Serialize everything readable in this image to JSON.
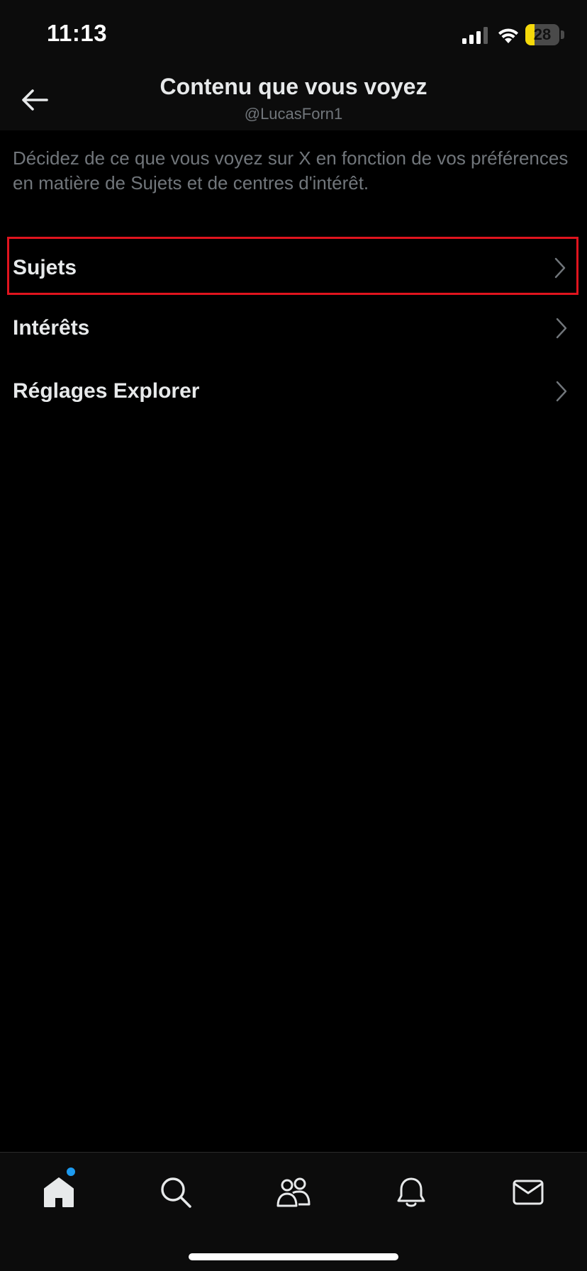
{
  "status_bar": {
    "time": "11:13",
    "battery_level": "28",
    "battery_fraction": 0.28,
    "battery_color": "#f5d90a"
  },
  "header": {
    "title": "Contenu que vous voyez",
    "subtitle": "@LucasForn1",
    "back_icon": "arrow-left-icon"
  },
  "description": "Décidez de ce que vous voyez sur X en fonction de vos préférences en matière de Sujets et de centres d'intérêt.",
  "menu": {
    "items": [
      {
        "label": "Sujets",
        "icon": "chevron-right-icon",
        "highlighted": true
      },
      {
        "label": "Intérêts",
        "icon": "chevron-right-icon",
        "highlighted": false
      },
      {
        "label": "Réglages Explorer",
        "icon": "chevron-right-icon",
        "highlighted": false
      }
    ]
  },
  "bottom_nav": {
    "items": [
      {
        "name": "home",
        "icon": "home-icon",
        "has_notification_dot": true
      },
      {
        "name": "search",
        "icon": "search-icon",
        "has_notification_dot": false
      },
      {
        "name": "communities",
        "icon": "communities-icon",
        "has_notification_dot": false
      },
      {
        "name": "notifications",
        "icon": "bell-icon",
        "has_notification_dot": false
      },
      {
        "name": "messages",
        "icon": "mail-icon",
        "has_notification_dot": false
      }
    ]
  },
  "colors": {
    "background": "#000000",
    "text_primary": "#e7e9ea",
    "text_secondary": "#71767b",
    "accent": "#1d9bf0",
    "highlight_border": "#e0141e"
  }
}
